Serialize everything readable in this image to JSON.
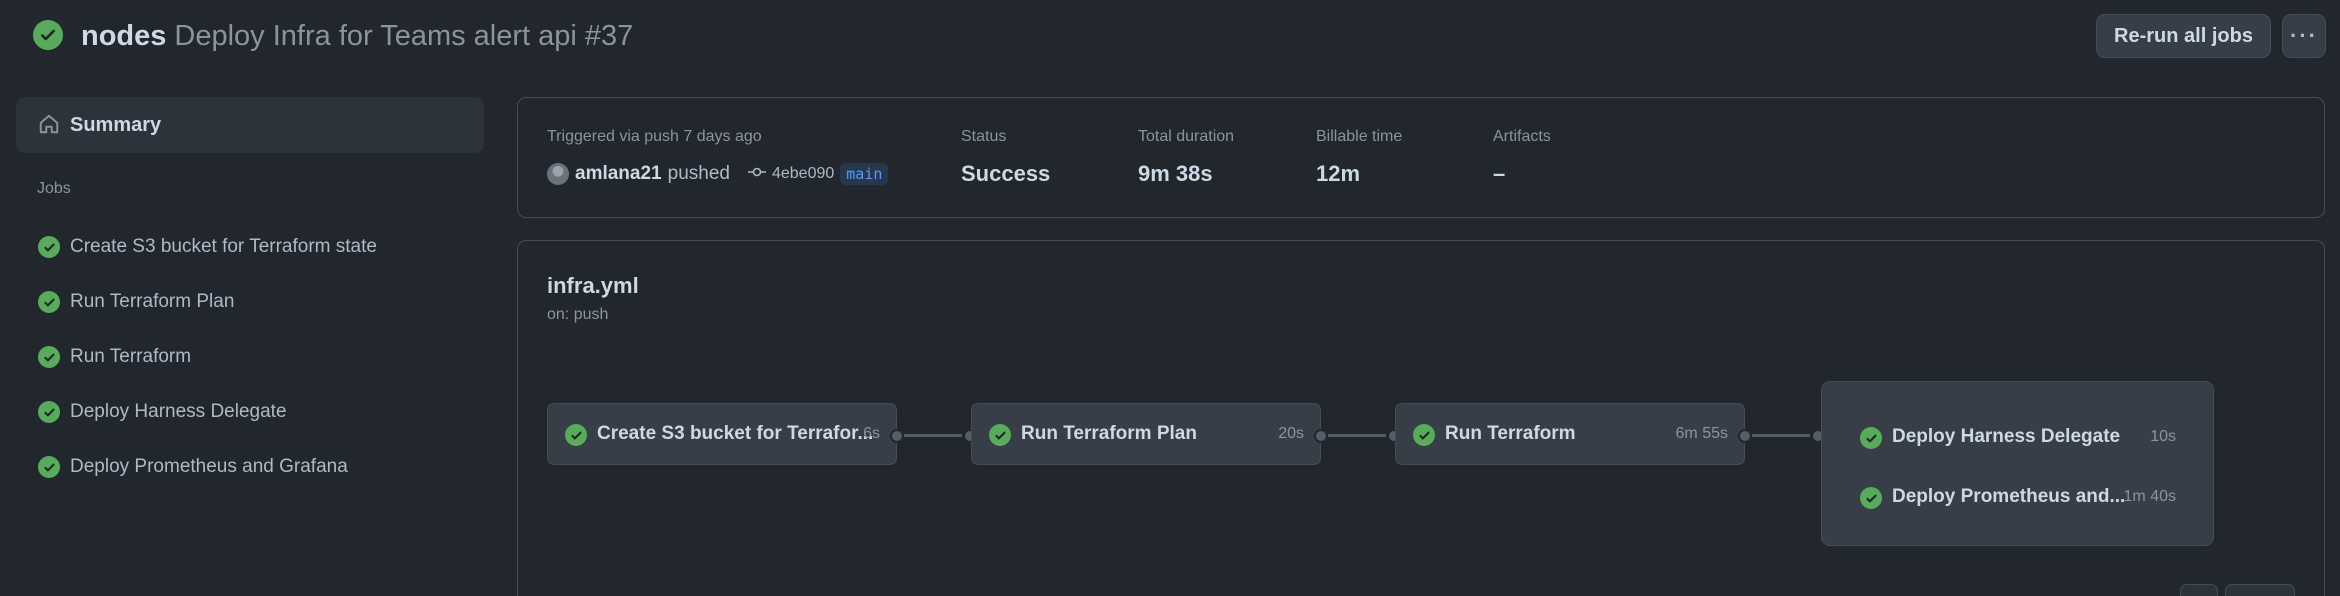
{
  "header": {
    "repo": "nodes",
    "run_title": "Deploy Infra for Teams alert api #37",
    "rerun_label": "Re-run all jobs",
    "more_label": "···"
  },
  "sidebar": {
    "summary_label": "Summary",
    "jobs_heading": "Jobs",
    "jobs": [
      {
        "label": "Create S3 bucket for Terraform state",
        "status": "success"
      },
      {
        "label": "Run Terraform Plan",
        "status": "success"
      },
      {
        "label": "Run Terraform",
        "status": "success"
      },
      {
        "label": "Deploy Harness Delegate",
        "status": "success"
      },
      {
        "label": "Deploy Prometheus and Grafana",
        "status": "success"
      }
    ]
  },
  "info": {
    "trigger_label": "Triggered via push 7 days ago",
    "actor": "amlana21",
    "action": "pushed",
    "commit": "4ebe090",
    "branch": "main",
    "status_label": "Status",
    "status_value": "Success",
    "duration_label": "Total duration",
    "duration_value": "9m 38s",
    "billable_label": "Billable time",
    "billable_value": "12m",
    "artifacts_label": "Artifacts",
    "artifacts_value": "–"
  },
  "workflow": {
    "file": "infra.yml",
    "trigger": "on: push",
    "nodes": [
      {
        "label": "Create S3 bucket for Terrafor...",
        "time": "6s"
      },
      {
        "label": "Run Terraform Plan",
        "time": "20s"
      },
      {
        "label": "Run Terraform",
        "time": "6m 55s"
      }
    ],
    "group": [
      {
        "label": "Deploy Harness Delegate",
        "time": "10s"
      },
      {
        "label": "Deploy Prometheus and...",
        "time": "1m 40s"
      }
    ]
  },
  "colors": {
    "success": "#57ab5a",
    "background": "#22272e",
    "branch": "#539bf5"
  },
  "icons": [
    "check-circle-icon",
    "home-icon",
    "commit-icon",
    "kebab-horizontal-icon"
  ]
}
